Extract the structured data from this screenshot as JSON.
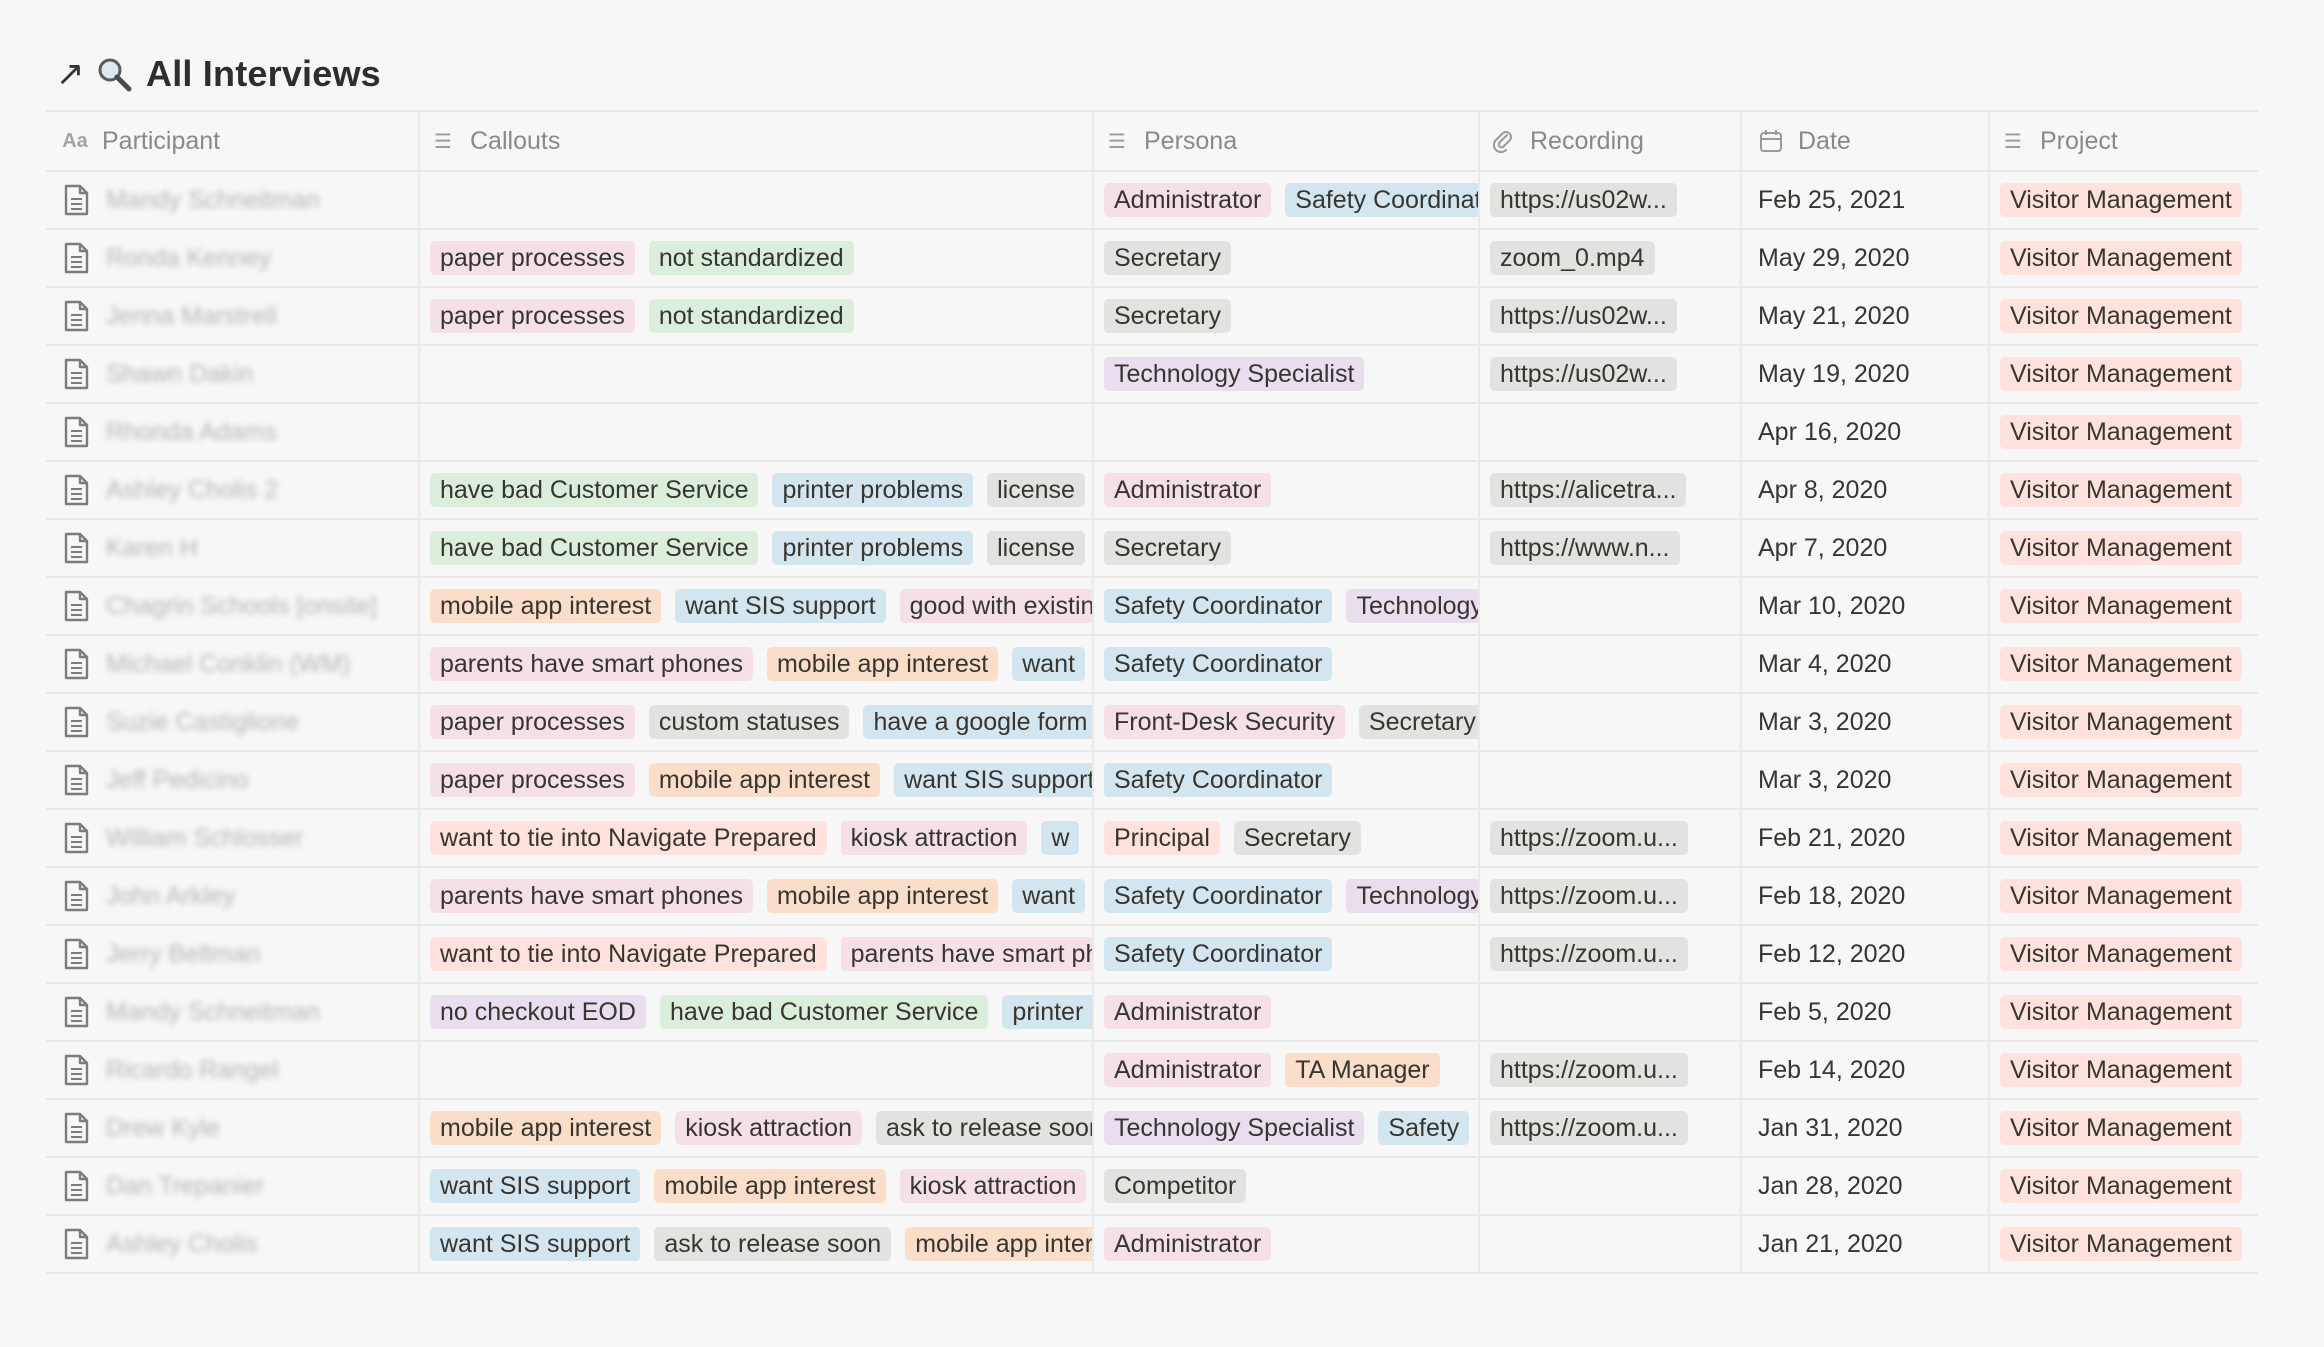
{
  "view": {
    "title": "All Interviews"
  },
  "colors": {
    "pink": "#f5e0e9",
    "green": "#dbeddb",
    "gray": "#e3e2e0",
    "purple": "#e8deee",
    "blue": "#d3e5ef",
    "orange": "#fadec9",
    "red": "#ffe2dd",
    "brown": "#eee0da",
    "yellow": "#fdecc8"
  },
  "columns": {
    "participant": "Participant",
    "callouts": "Callouts",
    "persona": "Persona",
    "recording": "Recording",
    "date": "Date",
    "project": "Project"
  },
  "rows": [
    {
      "participant": "Mandy Schneitman",
      "callouts": [],
      "persona": [
        {
          "t": "Administrator",
          "c": "pink"
        },
        {
          "t": "Safety Coordinator",
          "c": "blue"
        }
      ],
      "recording": "https://us02w...",
      "date": "Feb 25, 2021",
      "project": "Visitor Management"
    },
    {
      "participant": "Ronda Kenney",
      "callouts": [
        {
          "t": "paper processes",
          "c": "pink"
        },
        {
          "t": "not standardized",
          "c": "green"
        }
      ],
      "persona": [
        {
          "t": "Secretary",
          "c": "gray"
        }
      ],
      "recording": "zoom_0.mp4",
      "date": "May 29, 2020",
      "project": "Visitor Management"
    },
    {
      "participant": "Jenna Marstrell",
      "callouts": [
        {
          "t": "paper processes",
          "c": "pink"
        },
        {
          "t": "not standardized",
          "c": "green"
        }
      ],
      "persona": [
        {
          "t": "Secretary",
          "c": "gray"
        }
      ],
      "recording": "https://us02w...",
      "date": "May 21, 2020",
      "project": "Visitor Management"
    },
    {
      "participant": "Shawn Dakin",
      "callouts": [],
      "persona": [
        {
          "t": "Technology Specialist",
          "c": "purple"
        }
      ],
      "recording": "https://us02w...",
      "date": "May 19, 2020",
      "project": "Visitor Management"
    },
    {
      "participant": "Rhonda Adams",
      "callouts": [],
      "persona": [],
      "recording": "",
      "date": "Apr 16, 2020",
      "project": "Visitor Management"
    },
    {
      "participant": "Ashley Cholis 2",
      "callouts": [
        {
          "t": "have bad Customer Service",
          "c": "green"
        },
        {
          "t": "printer problems",
          "c": "blue"
        },
        {
          "t": "license",
          "c": "gray"
        }
      ],
      "persona": [
        {
          "t": "Administrator",
          "c": "pink"
        }
      ],
      "recording": "https://alicetra...",
      "date": "Apr 8, 2020",
      "project": "Visitor Management"
    },
    {
      "participant": "Karen H",
      "callouts": [
        {
          "t": "have bad Customer Service",
          "c": "green"
        },
        {
          "t": "printer problems",
          "c": "blue"
        },
        {
          "t": "license",
          "c": "gray"
        }
      ],
      "persona": [
        {
          "t": "Secretary",
          "c": "gray"
        }
      ],
      "recording": "https://www.n...",
      "date": "Apr 7, 2020",
      "project": "Visitor Management"
    },
    {
      "participant": "Chagrin Schools [onsite]",
      "callouts": [
        {
          "t": "mobile app interest",
          "c": "orange"
        },
        {
          "t": "want SIS support",
          "c": "blue"
        },
        {
          "t": "good with existing",
          "c": "pink"
        }
      ],
      "persona": [
        {
          "t": "Safety Coordinator",
          "c": "blue"
        },
        {
          "t": "Technology Specialist",
          "c": "purple"
        }
      ],
      "recording": "",
      "date": "Mar 10, 2020",
      "project": "Visitor Management"
    },
    {
      "participant": "Michael Conklin (WM)",
      "callouts": [
        {
          "t": "parents have smart phones",
          "c": "pink"
        },
        {
          "t": "mobile app interest",
          "c": "orange"
        },
        {
          "t": "want",
          "c": "blue"
        }
      ],
      "persona": [
        {
          "t": "Safety Coordinator",
          "c": "blue"
        }
      ],
      "recording": "",
      "date": "Mar 4, 2020",
      "project": "Visitor Management"
    },
    {
      "participant": "Suzie Castiglione",
      "callouts": [
        {
          "t": "paper processes",
          "c": "pink"
        },
        {
          "t": "custom statuses",
          "c": "gray"
        },
        {
          "t": "have a google form",
          "c": "blue"
        }
      ],
      "persona": [
        {
          "t": "Front-Desk Security",
          "c": "pink"
        },
        {
          "t": "Secretary",
          "c": "gray"
        }
      ],
      "recording": "",
      "date": "Mar 3, 2020",
      "project": "Visitor Management"
    },
    {
      "participant": "Jeff Pedicino",
      "callouts": [
        {
          "t": "paper processes",
          "c": "pink"
        },
        {
          "t": "mobile app interest",
          "c": "orange"
        },
        {
          "t": "want SIS support",
          "c": "blue"
        }
      ],
      "persona": [
        {
          "t": "Safety Coordinator",
          "c": "blue"
        }
      ],
      "recording": "",
      "date": "Mar 3, 2020",
      "project": "Visitor Management"
    },
    {
      "participant": "William Schlosser",
      "callouts": [
        {
          "t": "want to tie into Navigate Prepared",
          "c": "red"
        },
        {
          "t": "kiosk attraction",
          "c": "pink"
        },
        {
          "t": "w",
          "c": "blue"
        }
      ],
      "persona": [
        {
          "t": "Principal",
          "c": "red"
        },
        {
          "t": "Secretary",
          "c": "gray"
        }
      ],
      "recording": "https://zoom.u...",
      "date": "Feb 21, 2020",
      "project": "Visitor Management"
    },
    {
      "participant": "John Arkley",
      "callouts": [
        {
          "t": "parents have smart phones",
          "c": "pink"
        },
        {
          "t": "mobile app interest",
          "c": "orange"
        },
        {
          "t": "want",
          "c": "blue"
        }
      ],
      "persona": [
        {
          "t": "Safety Coordinator",
          "c": "blue"
        },
        {
          "t": "Technology Specialist",
          "c": "purple"
        }
      ],
      "recording": "https://zoom.u...",
      "date": "Feb 18, 2020",
      "project": "Visitor Management"
    },
    {
      "participant": "Jerry Beltman",
      "callouts": [
        {
          "t": "want to tie into Navigate Prepared",
          "c": "red"
        },
        {
          "t": "parents have smart phones",
          "c": "pink"
        }
      ],
      "persona": [
        {
          "t": "Safety Coordinator",
          "c": "blue"
        }
      ],
      "recording": "https://zoom.u...",
      "date": "Feb 12, 2020",
      "project": "Visitor Management"
    },
    {
      "participant": "Mandy Schneitman",
      "callouts": [
        {
          "t": "no checkout EOD",
          "c": "purple"
        },
        {
          "t": "have bad Customer Service",
          "c": "green"
        },
        {
          "t": "printer problems",
          "c": "blue"
        }
      ],
      "persona": [
        {
          "t": "Administrator",
          "c": "pink"
        }
      ],
      "recording": "",
      "date": "Feb 5, 2020",
      "project": "Visitor Management"
    },
    {
      "participant": "Ricardo Rangel",
      "callouts": [],
      "persona": [
        {
          "t": "Administrator",
          "c": "pink"
        },
        {
          "t": "TA Manager",
          "c": "orange"
        }
      ],
      "recording": "https://zoom.u...",
      "date": "Feb 14, 2020",
      "project": "Visitor Management"
    },
    {
      "participant": "Drew Kyle",
      "callouts": [
        {
          "t": "mobile app interest",
          "c": "orange"
        },
        {
          "t": "kiosk attraction",
          "c": "pink"
        },
        {
          "t": "ask to release soon",
          "c": "gray"
        }
      ],
      "persona": [
        {
          "t": "Technology Specialist",
          "c": "purple"
        },
        {
          "t": "Safety",
          "c": "blue"
        }
      ],
      "recording": "https://zoom.u...",
      "date": "Jan 31, 2020",
      "project": "Visitor Management"
    },
    {
      "participant": "Dan Trepanier",
      "callouts": [
        {
          "t": "want SIS support",
          "c": "blue"
        },
        {
          "t": "mobile app interest",
          "c": "orange"
        },
        {
          "t": "kiosk attraction",
          "c": "pink"
        }
      ],
      "persona": [
        {
          "t": "Competitor",
          "c": "gray"
        }
      ],
      "recording": "",
      "date": "Jan 28, 2020",
      "project": "Visitor Management"
    },
    {
      "participant": "Ashley Cholis",
      "callouts": [
        {
          "t": "want SIS support",
          "c": "blue"
        },
        {
          "t": "ask to release soon",
          "c": "gray"
        },
        {
          "t": "mobile app interest",
          "c": "orange"
        }
      ],
      "persona": [
        {
          "t": "Administrator",
          "c": "pink"
        }
      ],
      "recording": "",
      "date": "Jan 21, 2020",
      "project": "Visitor Management"
    }
  ]
}
